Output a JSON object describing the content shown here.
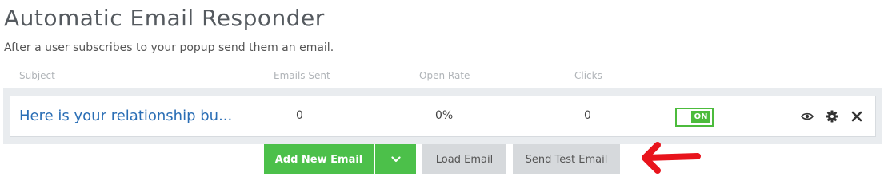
{
  "header": {
    "title": "Automatic Email Responder",
    "subtitle": "After a user subscribes to your popup send them an email."
  },
  "table": {
    "columns": [
      "Subject",
      "Emails Sent",
      "Open Rate",
      "Clicks"
    ],
    "rows": [
      {
        "subject": "Here is your relationship bu...",
        "emails_sent": "0",
        "open_rate": "0%",
        "clicks": "0",
        "status": "ON"
      }
    ]
  },
  "icons": {
    "preview": "eye-icon",
    "settings": "gear-icon",
    "delete": "close-icon",
    "dropdown": "chevron-down-icon"
  },
  "actions": {
    "add_new_email": "Add New Email",
    "load_email": "Load Email",
    "send_test_email": "Send Test Email"
  },
  "colors": {
    "accent_green": "#4cc04a",
    "link_blue": "#2a6eb5",
    "annotation_red": "#e8141c"
  }
}
